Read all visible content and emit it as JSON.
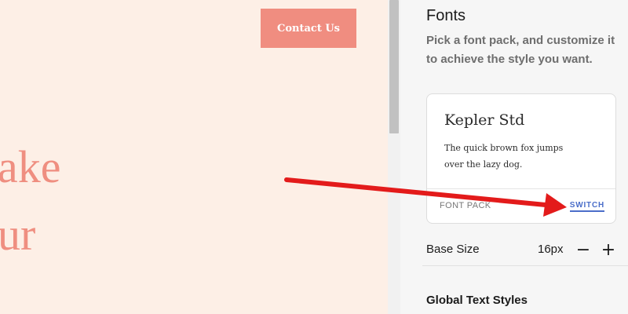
{
  "preview": {
    "contact_button_label": "Contact Us",
    "hero_line_1": "ake",
    "hero_line_2": "ur"
  },
  "panel": {
    "title": "Fonts",
    "description": "Pick a font pack, and customize it to achieve the style you want.",
    "font_card": {
      "font_name": "Kepler Std",
      "sample_text": "The quick brown fox jumps over the lazy dog.",
      "footer_label": "FONT PACK",
      "switch_label": "SWITCH"
    },
    "base_size": {
      "label": "Base Size",
      "value": "16px",
      "minus": "−",
      "plus": "+"
    },
    "global_text_styles": "Global Text Styles"
  },
  "colors": {
    "preview_bg": "#fdefe6",
    "accent_salmon": "#f08d80",
    "link_blue": "#4b6ec9",
    "annotation_red": "#e31b1b"
  }
}
